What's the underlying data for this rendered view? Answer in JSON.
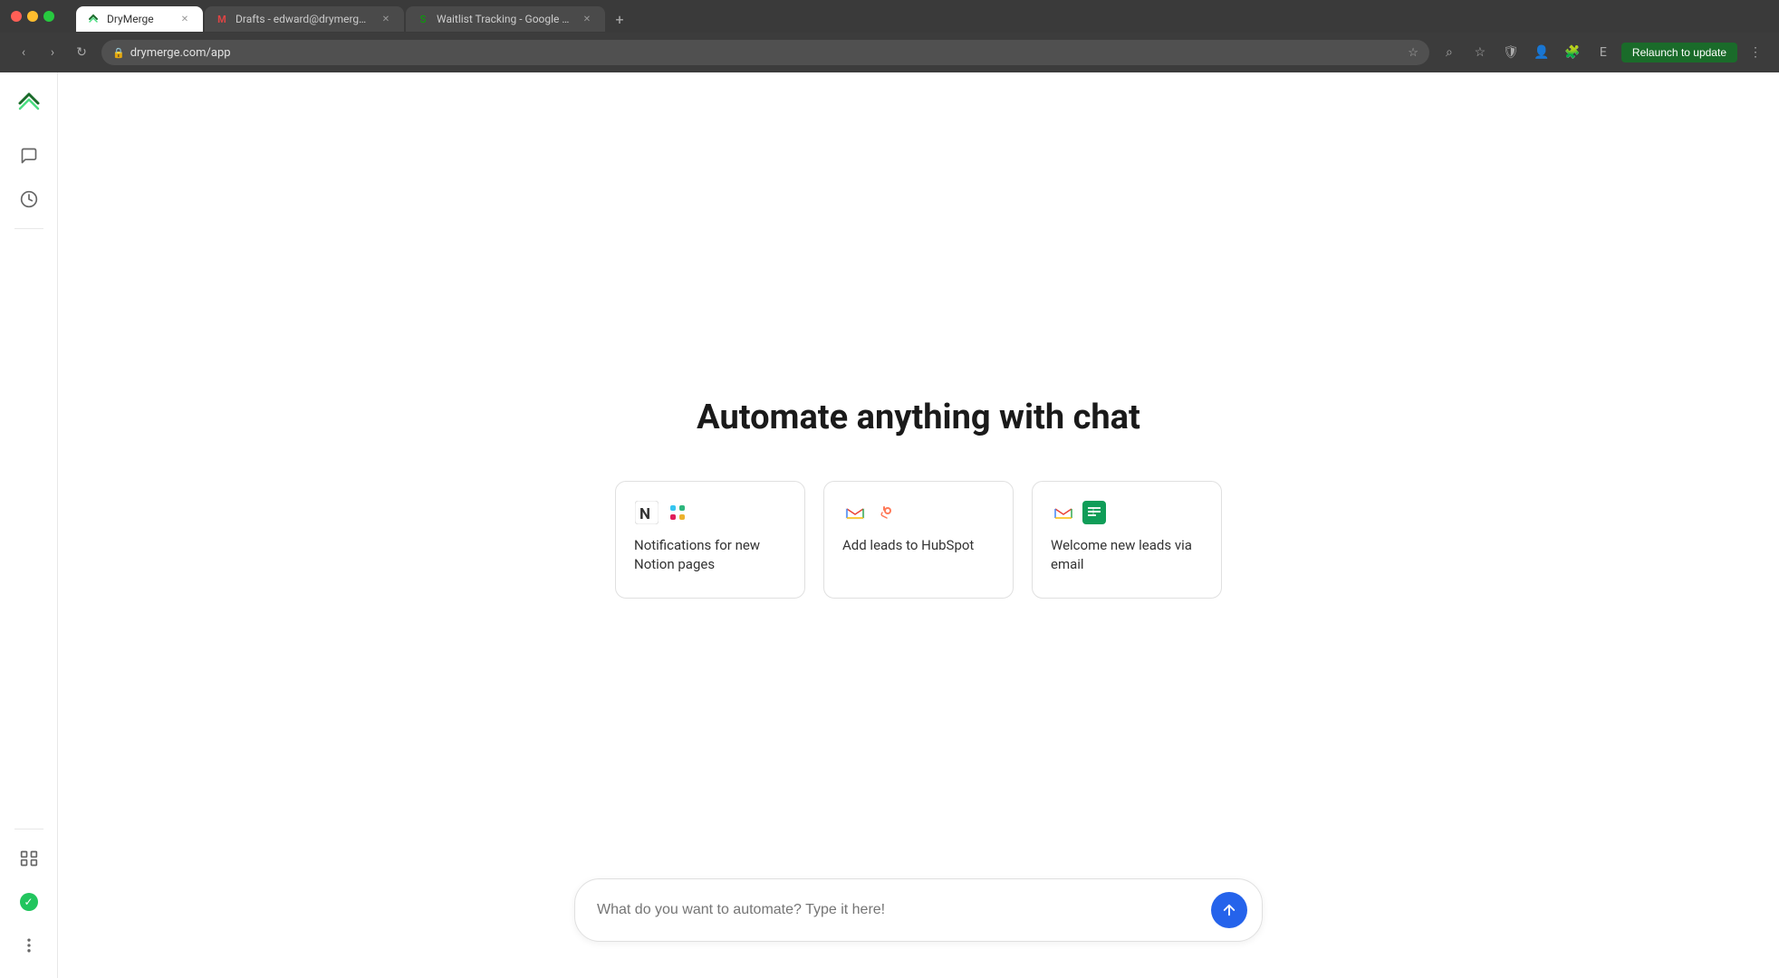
{
  "browser": {
    "tabs": [
      {
        "id": "drymerge",
        "title": "DryMerge",
        "favicon": "🔀",
        "active": true
      },
      {
        "id": "drafts",
        "title": "Drafts - edward@drymerge...",
        "favicon": "M",
        "active": false
      },
      {
        "id": "waitlist",
        "title": "Waitlist Tracking - Google Sh...",
        "favicon": "S",
        "active": false
      }
    ],
    "url": "drymerge.com/app",
    "relaunch_label": "Relaunch to update"
  },
  "sidebar": {
    "logo_alt": "DryMerge Logo",
    "items": [
      {
        "id": "chat",
        "icon": "chat",
        "label": "Chat"
      },
      {
        "id": "history",
        "icon": "history",
        "label": "History"
      }
    ],
    "bottom_items": [
      {
        "id": "integrations",
        "icon": "integrations",
        "label": "Integrations"
      },
      {
        "id": "status",
        "icon": "status",
        "label": "Status"
      },
      {
        "id": "more",
        "icon": "more",
        "label": "More"
      }
    ]
  },
  "main": {
    "heading": "Automate anything with chat",
    "suggestion_cards": [
      {
        "id": "notion-slack",
        "icons": [
          "notion",
          "slack"
        ],
        "text": "Notifications for new Notion pages"
      },
      {
        "id": "gmail-hubspot",
        "icons": [
          "gmail",
          "hubspot"
        ],
        "text": "Add leads to HubSpot"
      },
      {
        "id": "gmail-sheets",
        "icons": [
          "gmail",
          "sheets"
        ],
        "text": "Welcome new leads via email"
      }
    ],
    "chat_input": {
      "placeholder": "What do you want to automate? Type it here!",
      "send_button_label": "Send"
    }
  }
}
